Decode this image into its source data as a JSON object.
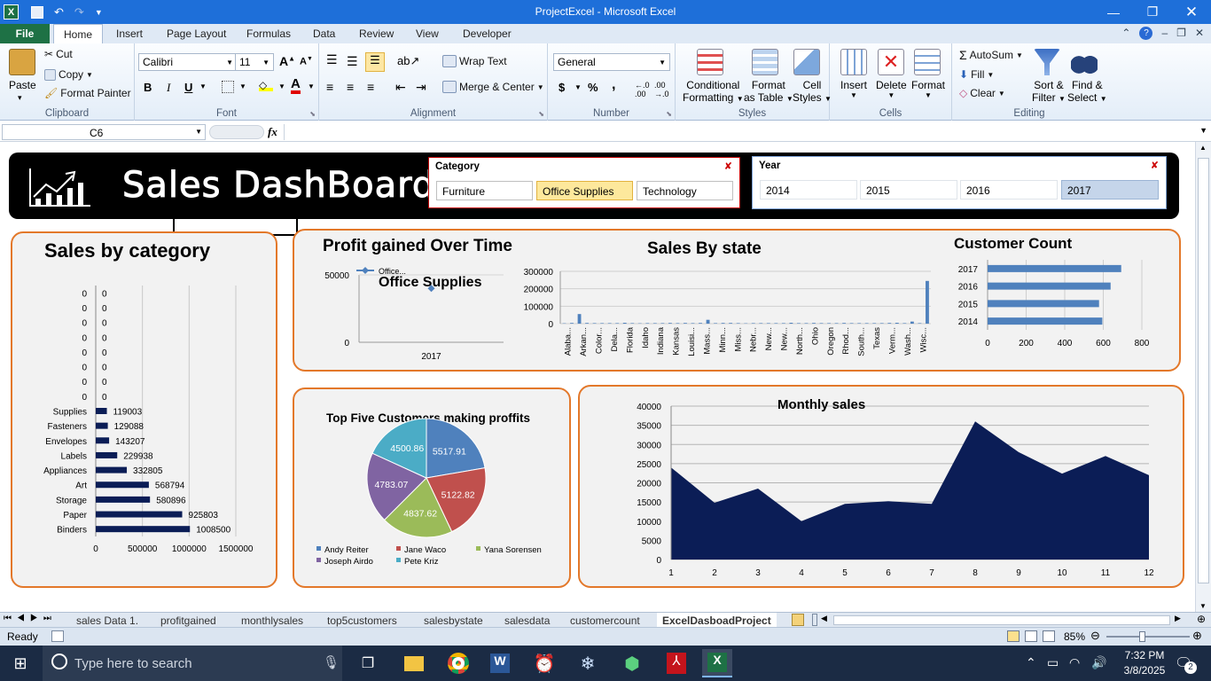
{
  "window": {
    "title": "ProjectExcel  -  Microsoft Excel"
  },
  "ribbon_tabs": [
    "File",
    "Home",
    "Insert",
    "Page Layout",
    "Formulas",
    "Data",
    "Review",
    "View",
    "Developer"
  ],
  "ribbon": {
    "clipboard": {
      "paste": "Paste",
      "cut": "Cut",
      "copy": "Copy",
      "format_painter": "Format Painter",
      "label": "Clipboard"
    },
    "font": {
      "name": "Calibri",
      "size": "11",
      "label": "Font",
      "bold": "B",
      "italic": "I",
      "underline": "U"
    },
    "alignment": {
      "wrap": "Wrap Text",
      "merge": "Merge & Center",
      "label": "Alignment"
    },
    "number": {
      "format": "General",
      "label": "Number",
      "currency": "$",
      "percent": "%",
      "comma": ","
    },
    "styles": {
      "conditional": "Conditional",
      "conditional2": "Formatting",
      "format_table": "Format",
      "format_table2": "as Table",
      "cell_styles": "Cell",
      "cell_styles2": "Styles",
      "label": "Styles"
    },
    "cells": {
      "insert": "Insert",
      "delete": "Delete",
      "format": "Format",
      "label": "Cells"
    },
    "editing": {
      "autosum": "AutoSum",
      "fill": "Fill",
      "clear": "Clear",
      "sort": "Sort &",
      "sort2": "Filter",
      "find": "Find &",
      "find2": "Select",
      "label": "Editing"
    }
  },
  "formula_bar": {
    "name_box": "C6",
    "fx": "fx",
    "formula": ""
  },
  "dashboard": {
    "title": "Sales DashBoard",
    "category_slicer": {
      "title": "Category",
      "items": [
        "Furniture",
        "Office Supplies",
        "Technology"
      ],
      "selected": "Office Supplies"
    },
    "year_slicer": {
      "title": "Year",
      "items": [
        "2014",
        "2015",
        "2016",
        "2017"
      ],
      "selected": "2017"
    }
  },
  "colors": {
    "accent_orange": "#e3782a",
    "navy": "#0b1d56",
    "bar_blue": "#4f81bd",
    "excel_green": "#1e7145"
  },
  "chart_data": [
    {
      "type": "bar",
      "orientation": "horizontal",
      "title": "Sales by category",
      "categories": [
        "",
        "",
        "",
        "",
        "",
        "",
        "",
        "",
        "Supplies",
        "Fasteners",
        "Envelopes",
        "Labels",
        "Appliances",
        "Art",
        "Storage",
        "Paper",
        "Binders"
      ],
      "values": [
        0,
        0,
        0,
        0,
        0,
        0,
        0,
        0,
        119003,
        129088,
        143207,
        229938,
        332805,
        568794,
        580896,
        925803,
        1008500
      ],
      "data_labels": [
        "0",
        "0",
        "0",
        "0",
        "0",
        "0",
        "0",
        "0",
        "119003",
        "129088",
        "143207",
        "229938",
        "332805",
        "568794",
        "580896",
        "925803",
        "1008500"
      ],
      "x_ticks": [
        "0",
        "500000",
        "1000000",
        "1500000"
      ],
      "xlim": [
        0,
        1500000
      ]
    },
    {
      "type": "line",
      "title": "Profit gained Over Time",
      "subtitle": "Office Supplies",
      "series": [
        {
          "name": "Office...",
          "x": [
            "2017"
          ],
          "values": [
            40000
          ]
        }
      ],
      "y_ticks": [
        "50000",
        "0"
      ],
      "x_ticks": [
        "2017"
      ],
      "ylim": [
        0,
        50000
      ]
    },
    {
      "type": "bar",
      "title": "Sales By state",
      "categories": [
        "Alaba...",
        "Arkan...",
        "Color...",
        "Dela...",
        "Florida",
        "Idaho",
        "Indiana",
        "Kansas",
        "Louisi...",
        "Mass...",
        "Minn...",
        "Miss...",
        "Nebr...",
        "New...",
        "New...",
        "North...",
        "Ohio",
        "Oregon",
        "Rhod...",
        "South...",
        "Texas",
        "Verm...",
        "Wash...",
        "Wisc..."
      ],
      "values": [
        2000,
        4000,
        55000,
        4000,
        3000,
        3000,
        3000,
        3000,
        5000,
        3000,
        2000,
        3000,
        3000,
        3000,
        4000,
        3000,
        4000,
        3000,
        4000,
        22000,
        3000,
        4000,
        4000,
        3000,
        2000,
        3000,
        3000,
        3000,
        3000,
        3000,
        5000,
        3000,
        3000,
        4000,
        3000,
        3000,
        3000,
        4000,
        3000,
        3000,
        3000,
        3000,
        3000,
        4000,
        5000,
        3000,
        12000,
        3000,
        245000
      ],
      "y_ticks": [
        "300000",
        "200000",
        "100000",
        "0"
      ],
      "ylim": [
        0,
        300000
      ]
    },
    {
      "type": "bar",
      "orientation": "horizontal",
      "title": "Customer Count",
      "categories": [
        "2017",
        "2016",
        "2015",
        "2014"
      ],
      "values": [
        693,
        638,
        578,
        595
      ],
      "x_ticks": [
        "0",
        "200",
        "400",
        "600",
        "800"
      ],
      "xlim": [
        0,
        800
      ]
    },
    {
      "type": "pie",
      "title": "Top Five Customers making proffits",
      "series": [
        {
          "name": "Andy Reiter",
          "value": 5517.91,
          "label": "5517.91",
          "color": "#4f81bd"
        },
        {
          "name": "Jane Waco",
          "value": 5122.82,
          "label": "5122.82",
          "color": "#c0504d"
        },
        {
          "name": "Yana Sorensen",
          "value": 4837.62,
          "label": "4837.62",
          "color": "#9bbb59"
        },
        {
          "name": "Joseph Airdo",
          "value": 4783.07,
          "label": "4783.07",
          "color": "#8064a2"
        },
        {
          "name": "Pete Kriz",
          "value": 4500.86,
          "label": "4500.86",
          "color": "#4bacc6"
        }
      ]
    },
    {
      "type": "area",
      "title": "Monthly sales",
      "x": [
        "1",
        "2",
        "3",
        "4",
        "5",
        "6",
        "7",
        "8",
        "9",
        "10",
        "11",
        "12"
      ],
      "values": [
        24000,
        14800,
        18500,
        10000,
        14500,
        15200,
        14500,
        36000,
        28000,
        22400,
        27000,
        22000
      ],
      "y_ticks": [
        "40000",
        "35000",
        "30000",
        "25000",
        "20000",
        "15000",
        "10000",
        "5000",
        "0"
      ],
      "ylim": [
        0,
        40000
      ]
    }
  ],
  "sheet_tabs": [
    "sales Data 1.",
    "profitgained",
    "monthlysales",
    "top5customers",
    "salesbystate",
    "salesdata",
    "customercount",
    "ExcelDasboadProject"
  ],
  "active_sheet": "ExcelDasboadProject",
  "status": {
    "ready": "Ready",
    "zoom": "85%"
  },
  "taskbar": {
    "search_placeholder": "Type here to search",
    "time": "7:32 PM",
    "date": "3/8/2025",
    "notifications": "2"
  }
}
